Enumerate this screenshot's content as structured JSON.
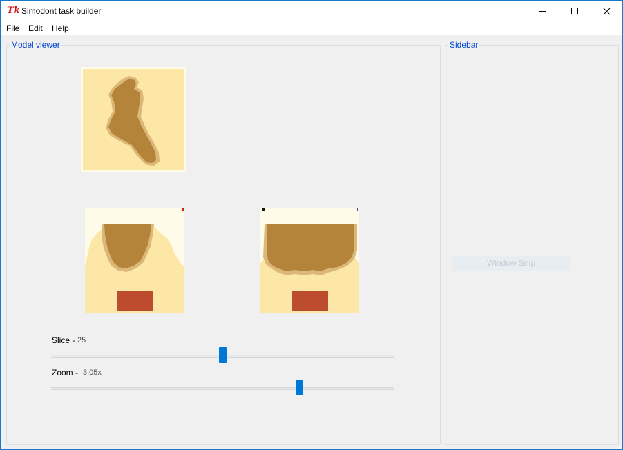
{
  "window": {
    "title": "Simodont task builder",
    "icon": "tk-feather-icon"
  },
  "menu": {
    "items": [
      "File",
      "Edit",
      "Help"
    ]
  },
  "model_viewer": {
    "title": "Model viewer",
    "views": [
      {
        "name": "top-view",
        "icon": "tooth-slice-top-view"
      },
      {
        "name": "front-view",
        "icon": "tooth-slice-front-view"
      },
      {
        "name": "side-view",
        "icon": "tooth-slice-side-view"
      }
    ],
    "slice": {
      "label": "Slice -",
      "value": "25",
      "fraction": 0.5
    },
    "zoom": {
      "label": "Zoom -",
      "value": "3.05x",
      "fraction": 0.723
    }
  },
  "sidebar": {
    "title": "Sidebar",
    "snip_button_label": "Window Snip",
    "snip_button_enabled": false
  },
  "colors": {
    "accent": "#0078d7",
    "group_title": "#0046d5",
    "tooth": "#b3843a",
    "tooth_edge": "#dbb878",
    "pulp_background": "#fde7a6",
    "cavity": "#bd4b2d"
  }
}
